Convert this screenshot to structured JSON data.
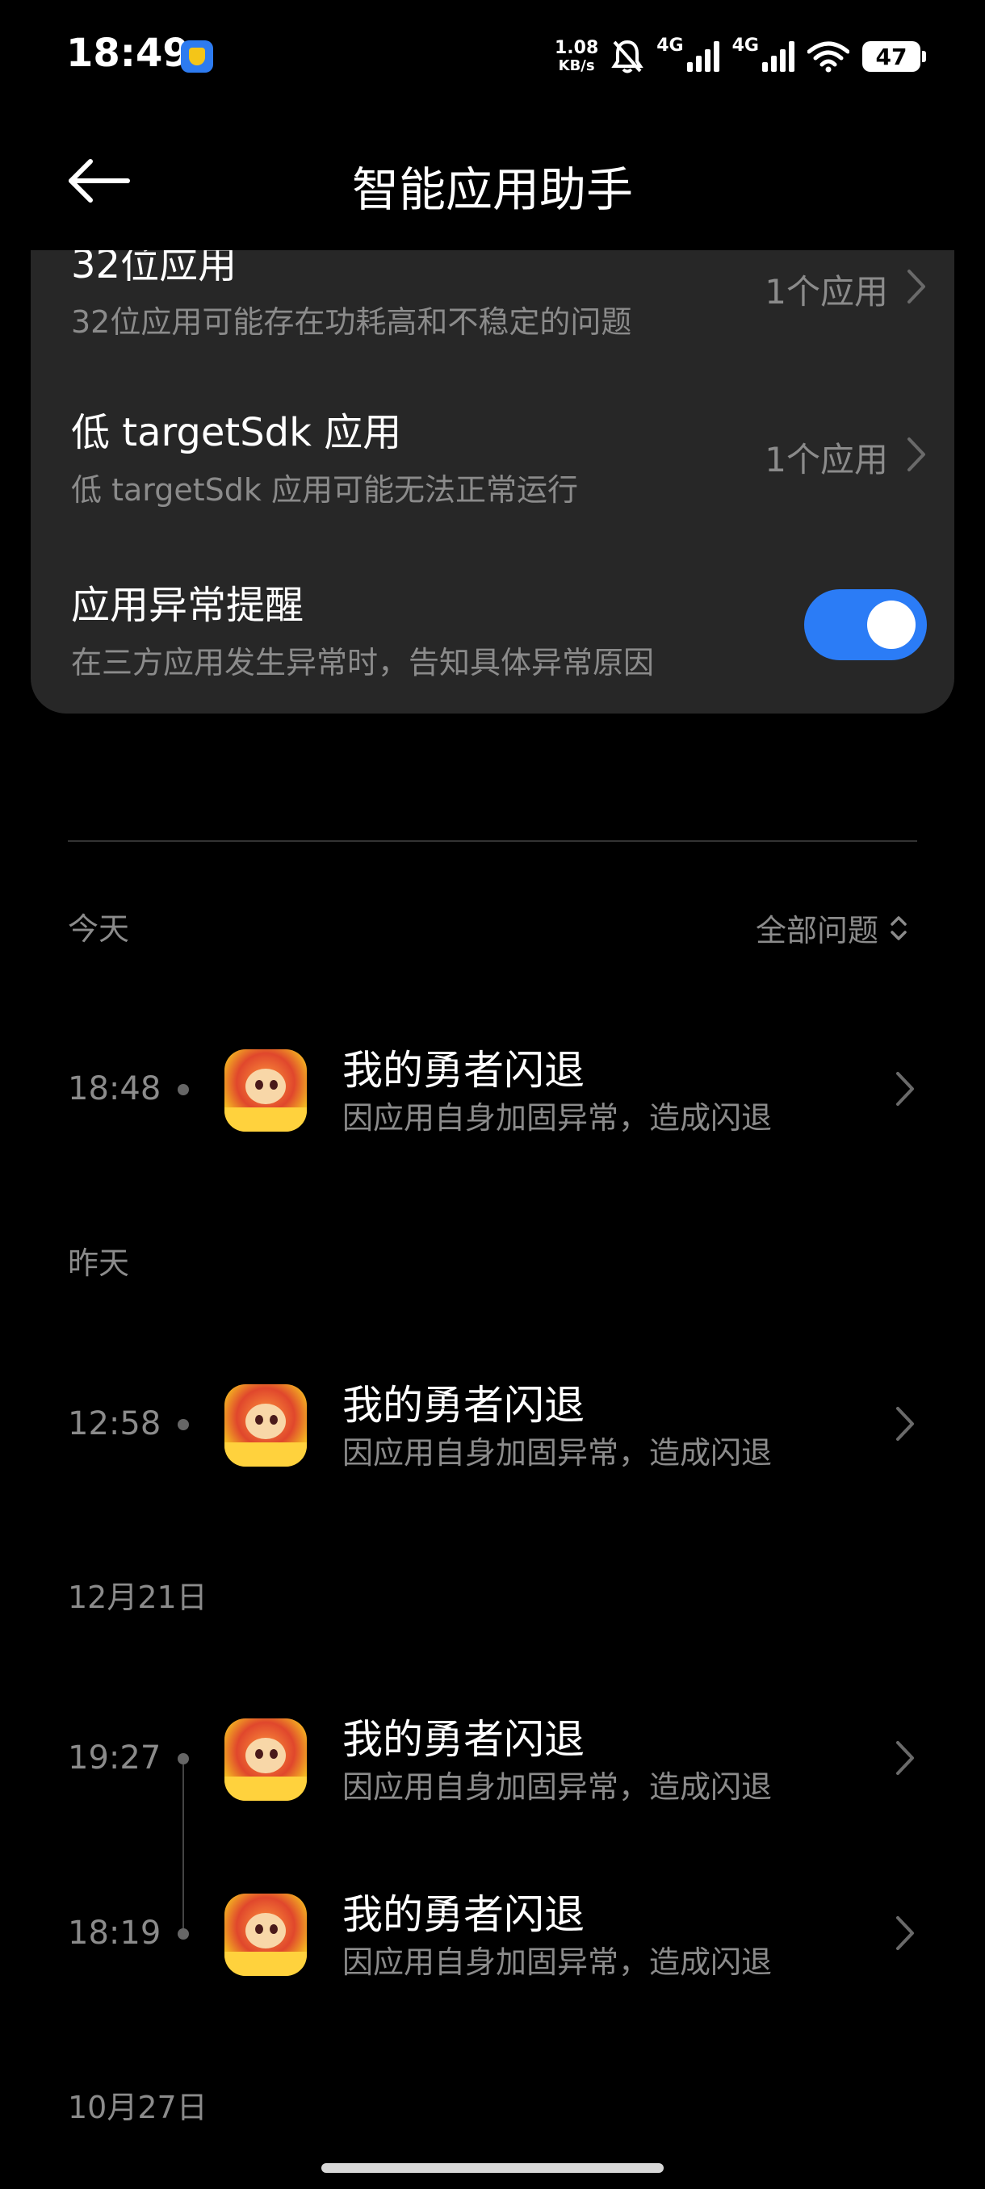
{
  "status_bar": {
    "time": "18:49",
    "net_speed_value": "1.08",
    "net_speed_unit": "KB/s",
    "network_1": "4G",
    "network_2": "4G",
    "battery": "47",
    "icons": [
      "app-notification-icon",
      "bell-muted-icon",
      "signal-icon",
      "signal-icon",
      "wifi-icon",
      "battery-icon"
    ]
  },
  "header": {
    "title": "智能应用助手",
    "back_icon": "back-arrow-icon"
  },
  "settings": [
    {
      "title": "32位应用",
      "subtitle": "32位应用可能存在功耗高和不稳定的问题",
      "value": "1个应用"
    },
    {
      "title": "低 targetSdk 应用",
      "subtitle": "低 targetSdk 应用可能无法正常运行",
      "value": "1个应用"
    },
    {
      "title": "应用异常提醒",
      "subtitle": "在三方应用发生异常时，告知具体异常原因",
      "toggle_on": true
    }
  ],
  "filter": {
    "label": "全部问题"
  },
  "groups": [
    {
      "label": "今天",
      "events": [
        {
          "time": "18:48",
          "app": "我的勇者闪退",
          "reason": "因应用自身加固异常，造成闪退"
        }
      ]
    },
    {
      "label": "昨天",
      "events": [
        {
          "time": "12:58",
          "app": "我的勇者闪退",
          "reason": "因应用自身加固异常，造成闪退"
        }
      ]
    },
    {
      "label": "12月21日",
      "events": [
        {
          "time": "19:27",
          "app": "我的勇者闪退",
          "reason": "因应用自身加固异常，造成闪退"
        },
        {
          "time": "18:19",
          "app": "我的勇者闪退",
          "reason": "因应用自身加固异常，造成闪退"
        }
      ]
    },
    {
      "label": "10月27日",
      "events": []
    }
  ],
  "colors": {
    "accent": "#2b7cf6",
    "card_bg": "#272727",
    "secondary_text": "#8b8b8b",
    "background": "#000000"
  }
}
